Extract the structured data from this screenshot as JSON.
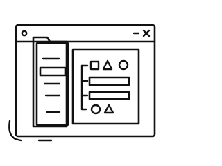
{
  "illustration": {
    "subject": "app-window-icon",
    "stroke_color": "#111111",
    "background_color": "#ffffff",
    "window": {
      "title_bar_icons": [
        "window-dot-icon",
        "minimize-icon",
        "close-icon"
      ]
    },
    "sidebar": {
      "tab_count": 2,
      "line_items": 4,
      "highlighted_item_index": 1
    },
    "panel": {
      "rows": [
        {
          "type": "shapes",
          "shapes": [
            "square-icon",
            "triangle-icon",
            "circle-icon"
          ]
        },
        {
          "type": "bar"
        },
        {
          "type": "bar"
        },
        {
          "type": "shapes",
          "shapes": [
            "circle-icon",
            "triangle-icon"
          ]
        }
      ]
    }
  }
}
